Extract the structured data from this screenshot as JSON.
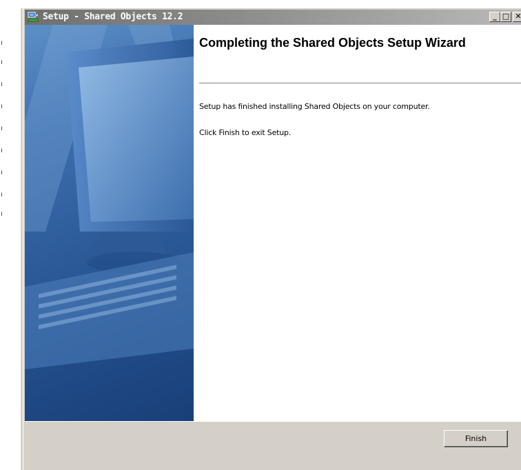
{
  "window": {
    "title": "Setup - Shared Objects 12.2",
    "minimize_glyph": "_",
    "maximize_glyph": "□",
    "close_glyph": "✕"
  },
  "wizard": {
    "heading": "Completing the Shared Objects Setup Wizard",
    "finished_text": "Setup has finished installing Shared Objects on your computer.",
    "exit_text": "Click Finish to exit Setup.",
    "side_image": "computer-monitor-keyboard-illustration"
  },
  "buttons": {
    "finish_label": "Finish"
  },
  "colors": {
    "title_bar_start": "#6f6f6f",
    "title_bar_end": "#b9b9b9",
    "dialog_face": "#d4d0c8",
    "side_image_blue": "#2c5a99"
  }
}
